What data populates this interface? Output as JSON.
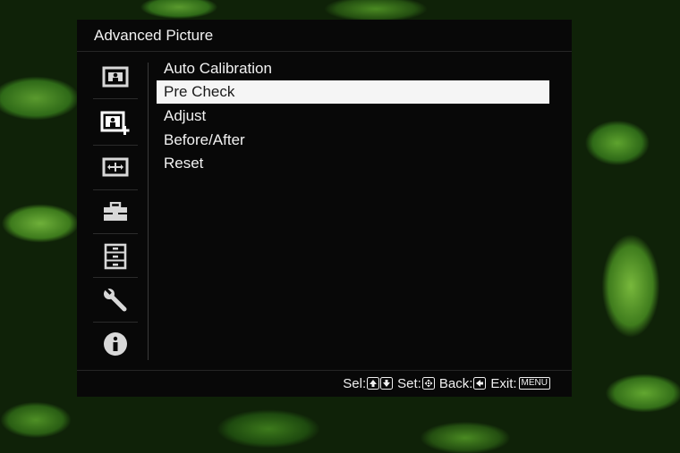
{
  "menu": {
    "title": "Advanced Picture",
    "items": [
      {
        "label": "Auto Calibration"
      },
      {
        "label": "Pre Check"
      },
      {
        "label": "Adjust"
      },
      {
        "label": "Before/After"
      },
      {
        "label": "Reset"
      }
    ],
    "selected_index": 1
  },
  "sidebar": {
    "icons": [
      "picture-icon",
      "advanced-picture-icon",
      "screen-icon",
      "toolbox-icon",
      "cabinet-icon",
      "wrench-icon",
      "info-icon"
    ],
    "active_index": 1
  },
  "help": {
    "sel_label": "Sel:",
    "set_label": "Set:",
    "back_label": "Back:",
    "exit_label": "Exit:",
    "menu_key": "MENU"
  }
}
